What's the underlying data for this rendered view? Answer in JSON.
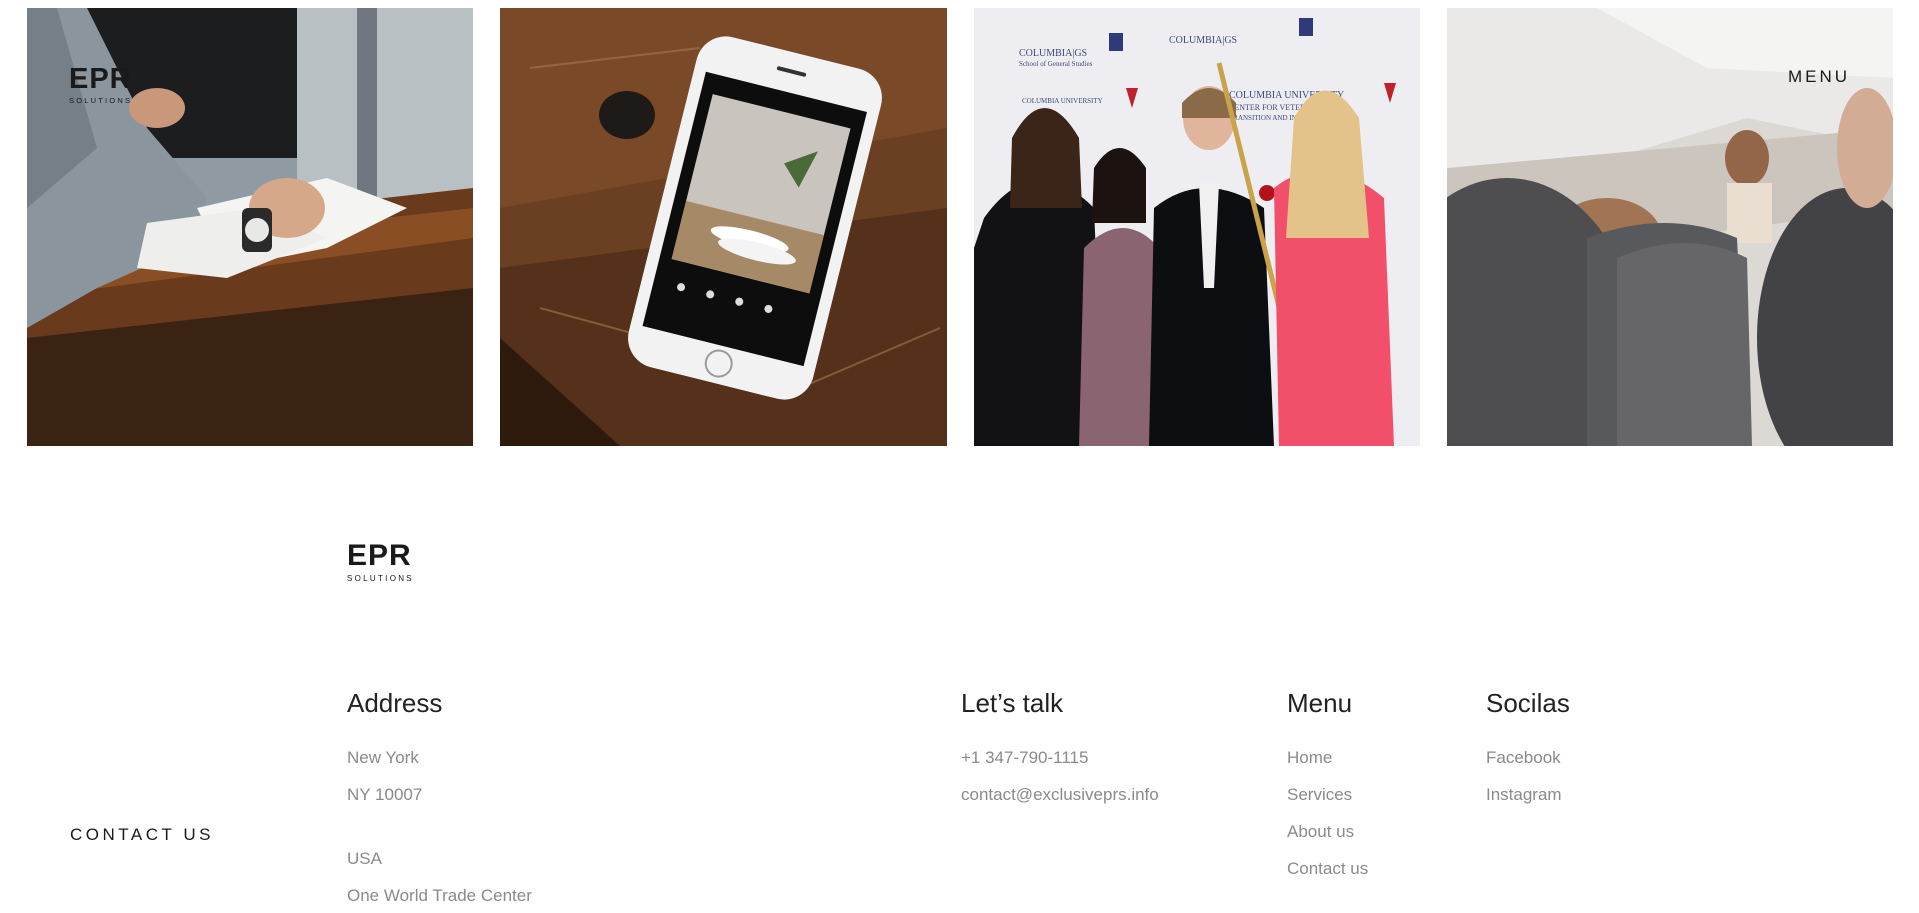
{
  "header": {
    "logo": {
      "mark": "EPR",
      "sub": "SOLUTIONS"
    },
    "menu_label": "MENU"
  },
  "gallery": {
    "photos": [
      {
        "subject": "hands-with-watch-signing-document"
      },
      {
        "subject": "smartphone-photo-editor-on-wooden-table"
      },
      {
        "subject": "group-at-columbia-university-event"
      },
      {
        "subject": "airplane-cabin-interior"
      }
    ],
    "photo3_backdrop": {
      "line1": "COLUMBIA|GS",
      "line2": "School of General Studies",
      "line3": "COLUMBIA UNIVERSITY",
      "line4": "CENTER FOR VETERAN",
      "line5": "TRANSITION AND INTEGRATION"
    }
  },
  "footer": {
    "logo": {
      "mark": "EPR",
      "sub": "SOLUTIONS"
    },
    "contact_us": "CONTACT US",
    "address": {
      "title": "Address",
      "lines": [
        "New York",
        "NY 10007"
      ],
      "lines2": [
        "USA",
        "One World Trade Center"
      ]
    },
    "talk": {
      "title": "Let’s talk",
      "phone": "+1 347-790-1115",
      "email": "contact@exclusiveprs.info"
    },
    "menu": {
      "title": "Menu",
      "items": [
        "Home",
        "Services",
        "About us",
        "Contact us"
      ]
    },
    "socials": {
      "title": "Socilas",
      "items": [
        "Facebook",
        "Instagram"
      ]
    }
  },
  "colors": {
    "text_dark": "#1a1a1a",
    "text_muted": "#8a8a8a",
    "background": "#ffffff"
  }
}
